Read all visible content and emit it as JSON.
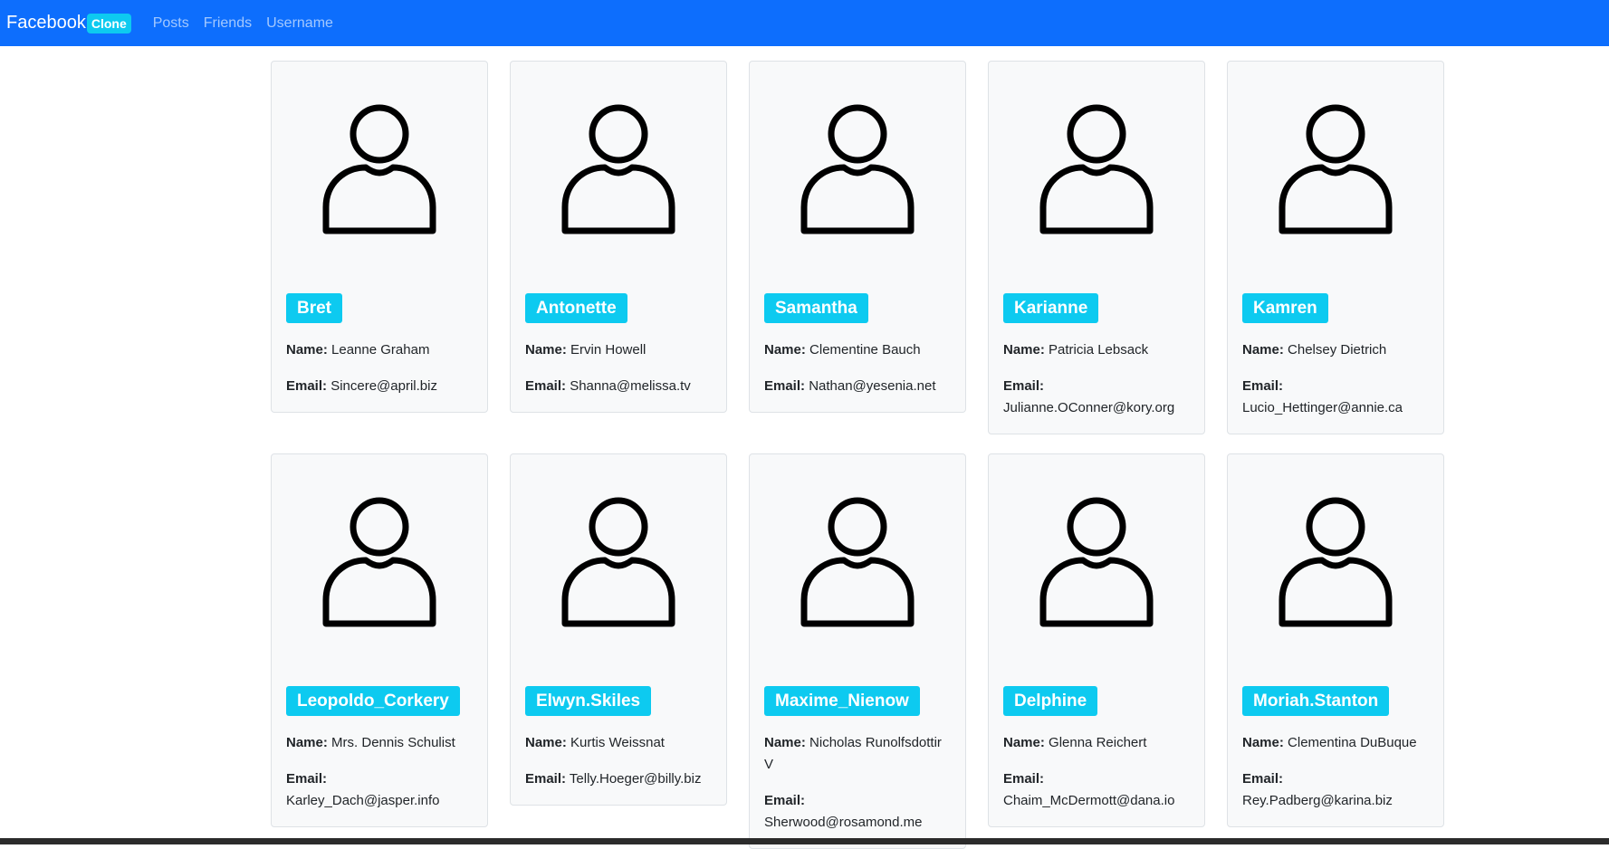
{
  "navbar": {
    "brand": "Facebook",
    "brand_badge": "Clone",
    "links": [
      "Posts",
      "Friends",
      "Username"
    ],
    "bg_color": "#0d6efd"
  },
  "labels": {
    "name": "Name:",
    "email": "Email:"
  },
  "users": [
    {
      "username": "Bret",
      "name": "Leanne Graham",
      "email": "Sincere@april.biz"
    },
    {
      "username": "Antonette",
      "name": "Ervin Howell",
      "email": "Shanna@melissa.tv"
    },
    {
      "username": "Samantha",
      "name": "Clementine Bauch",
      "email": "Nathan@yesenia.net"
    },
    {
      "username": "Karianne",
      "name": "Patricia Lebsack",
      "email": "Julianne.OConner@kory.org"
    },
    {
      "username": "Kamren",
      "name": "Chelsey Dietrich",
      "email": "Lucio_Hettinger@annie.ca"
    },
    {
      "username": "Leopoldo_Corkery",
      "name": "Mrs. Dennis Schulist",
      "email": "Karley_Dach@jasper.info"
    },
    {
      "username": "Elwyn.Skiles",
      "name": "Kurtis Weissnat",
      "email": "Telly.Hoeger@billy.biz"
    },
    {
      "username": "Maxime_Nienow",
      "name": "Nicholas Runolfsdottir V",
      "email": "Sherwood@rosamond.me"
    },
    {
      "username": "Delphine",
      "name": "Glenna Reichert",
      "email": "Chaim_McDermott@dana.io"
    },
    {
      "username": "Moriah.Stanton",
      "name": "Clementina DuBuque",
      "email": "Rey.Padberg@karina.biz"
    }
  ],
  "colors": {
    "badge": "#0dcaf0",
    "card_bg": "#f8f9fa"
  },
  "icons": {
    "avatar": "person-outline-icon"
  }
}
